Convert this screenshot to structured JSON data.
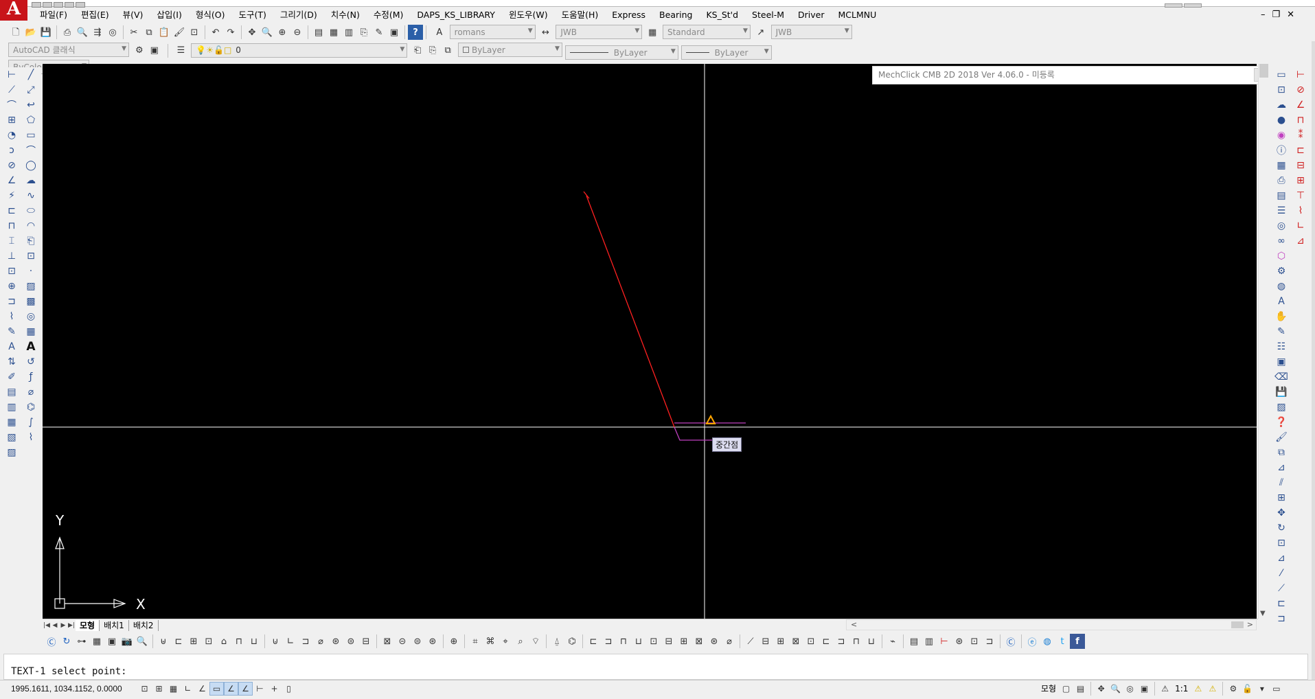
{
  "menu": {
    "items": [
      "파일(F)",
      "편집(E)",
      "뷰(V)",
      "삽입(I)",
      "형식(O)",
      "도구(T)",
      "그리기(D)",
      "치수(N)",
      "수정(M)",
      "DAPS_KS_LIBRARY",
      "윈도우(W)",
      "도움말(H)",
      "Express",
      "Bearing",
      "KS_St'd",
      "Steel-M",
      "Driver",
      "MCLMNU"
    ],
    "window_controls": [
      "–",
      "❐",
      "✕"
    ]
  },
  "toolbar_standard": {
    "text_style": "romans",
    "dim_style": "JWB",
    "table_style": "Standard",
    "multileader_style": "JWB"
  },
  "toolbar_layers": {
    "workspace": "AutoCAD 클래식",
    "current_layer": "0",
    "color": "ByLayer",
    "linetype": "ByLayer",
    "lineweight": "ByLayer",
    "plotstyle": "ByColor"
  },
  "mechclick": {
    "title": "MechClick CMB 2D 2018  Ver 4.06.0 - 미등록"
  },
  "canvas": {
    "tooltip": "중간점",
    "ucs_y": "Y",
    "ucs_x": "X"
  },
  "layout_tabs": {
    "tabs": [
      "모형",
      "배치1",
      "배치2"
    ],
    "active": "모형"
  },
  "command": {
    "prompt": "TEXT-1 select point:"
  },
  "status": {
    "coordinates": "1995.1611, 1034.1152, 0.0000",
    "model_label": "모형",
    "annotation_scale": "1:1"
  },
  "colors": {
    "canvas_bg": "#000000",
    "crosshair": "#ffffff",
    "red_line": "#ff2020",
    "snap_purple": "#c040c0",
    "snap_marker": "#ffa500",
    "brand_red": "#c8141a"
  }
}
